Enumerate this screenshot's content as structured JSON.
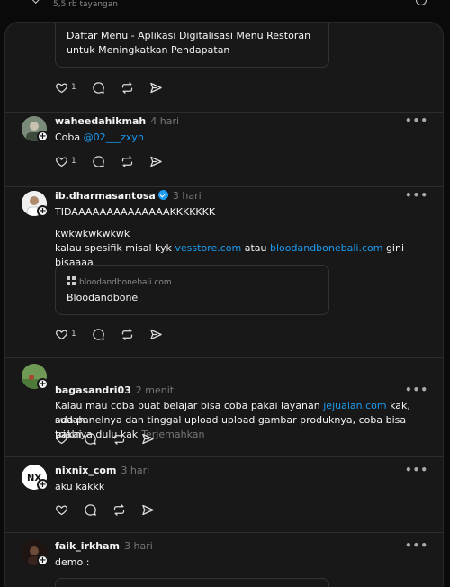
{
  "header": {
    "views": "5,5 rb tayangan"
  },
  "posts": [
    {
      "card": {
        "domain": "",
        "title": "Daftar Menu - Aplikasi Digitalisasi Menu Restoran untuk Meningkatkan Pendapatan"
      },
      "likes": "1"
    },
    {
      "username": "waheedahikmah",
      "time": "4 hari",
      "text_prefix": "Coba ",
      "mention": "@02___zxyn",
      "likes": "1"
    },
    {
      "username": "ib.dharmasantosa",
      "time": "3 hari",
      "verified": true,
      "line1": "TIDAAAAAAAAAAAAAAKKKKKKK",
      "line2": "kwkwkwkwkwk",
      "line3_prefix": "kalau spesifik misal kyk ",
      "link1": "vesstore.com",
      "line3_mid": " atau ",
      "link2": "bloodandbonebali.com",
      "line3_suffix": " gini bisaaaa",
      "card": {
        "domain": "bloodandbonebali.com",
        "title": "Bloodandbone"
      },
      "likes": "1"
    },
    {
      "username": "bagasandri03",
      "time": "2 menit",
      "text_prefix": "Kalau mau coba buat belajar bisa coba pakai layanan ",
      "link": "jejualan.com",
      "text_suffix1": " kak, sudah",
      "line2": "ada panelnya dan tinggal upload upload gambar produknya, coba bisa pakai",
      "line3": "trialnya dulu kak",
      "translate": "Terjemahkan"
    },
    {
      "username": "nixnix_com",
      "time": "3 hari",
      "text": "aku kakkk"
    },
    {
      "username": "faik_irkham",
      "time": "3 hari",
      "text": "demo :"
    }
  ],
  "icons": {
    "like": "heart-icon",
    "reply": "comment-icon",
    "repost": "repost-icon",
    "share": "share-icon",
    "more": "more-icon",
    "follow": "plus-icon",
    "verified": "verified-badge-icon"
  },
  "colors": {
    "background": "#0a0a0a",
    "panel": "#181818",
    "link": "#1d9bf0",
    "muted": "#777777"
  },
  "more_label": "•••",
  "plus_label": "+"
}
